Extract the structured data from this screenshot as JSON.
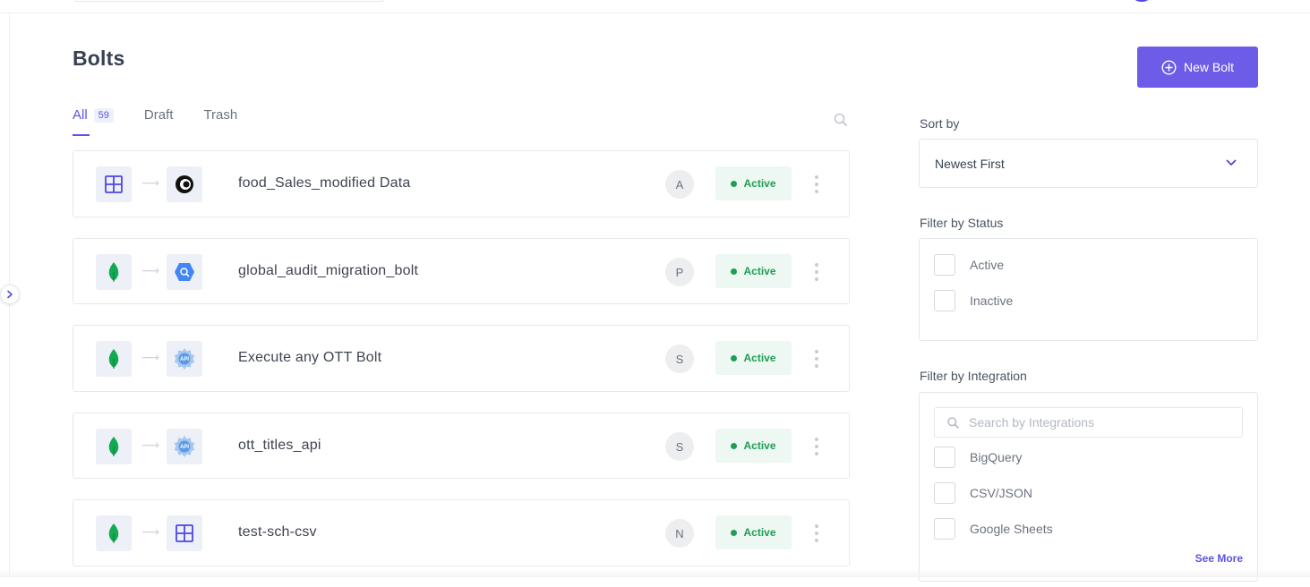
{
  "page": {
    "title": "Bolts",
    "new_button_label": "New Bolt"
  },
  "tabs": [
    {
      "label": "All",
      "count": "59",
      "active": true
    },
    {
      "label": "Draft"
    },
    {
      "label": "Trash"
    }
  ],
  "bolts": [
    {
      "name": "food_Sales_modified Data",
      "owner": "A",
      "status": "Active",
      "source_icon": "google-sheets-icon",
      "destination_icon": "webhook-icon"
    },
    {
      "name": "global_audit_migration_bolt",
      "owner": "P",
      "status": "Active",
      "source_icon": "mongodb-icon",
      "destination_icon": "bigquery-icon"
    },
    {
      "name": "Execute any OTT Bolt",
      "owner": "S",
      "status": "Active",
      "source_icon": "mongodb-icon",
      "destination_icon": "api-icon"
    },
    {
      "name": "ott_titles_api",
      "owner": "S",
      "status": "Active",
      "source_icon": "mongodb-icon",
      "destination_icon": "api-icon"
    },
    {
      "name": "test-sch-csv",
      "owner": "N",
      "status": "Active",
      "source_icon": "mongodb-icon",
      "destination_icon": "google-sheets-icon"
    }
  ],
  "sort": {
    "label": "Sort by",
    "value": "Newest First"
  },
  "status_filter": {
    "label": "Filter by Status",
    "options": [
      "Active",
      "Inactive"
    ]
  },
  "integration_filter": {
    "label": "Filter by Integration",
    "search_placeholder": "Search by Integrations",
    "options": [
      "BigQuery",
      "CSV/JSON",
      "Google Sheets"
    ],
    "see_more": "See More"
  },
  "colors": {
    "accent": "#6c5ce7",
    "status_active": "#1f9d55",
    "mongodb_green": "#13aa52",
    "bigquery_blue": "#4285f4"
  }
}
